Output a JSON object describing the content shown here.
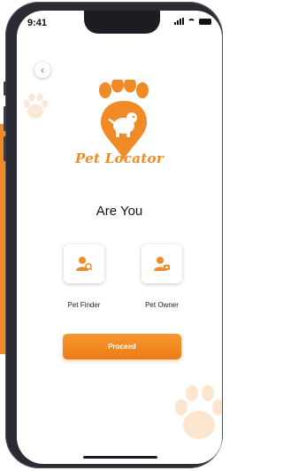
{
  "status": {
    "time": "9:41"
  },
  "brand": {
    "name": "Pet Locator"
  },
  "prompt": {
    "question": "Are You"
  },
  "roles": [
    {
      "label": "Pet Finder"
    },
    {
      "label": "Pet Owner"
    }
  ],
  "actions": {
    "proceed_label": "Proceed"
  },
  "colors": {
    "accent": "#f08a24",
    "text": "#111111"
  }
}
